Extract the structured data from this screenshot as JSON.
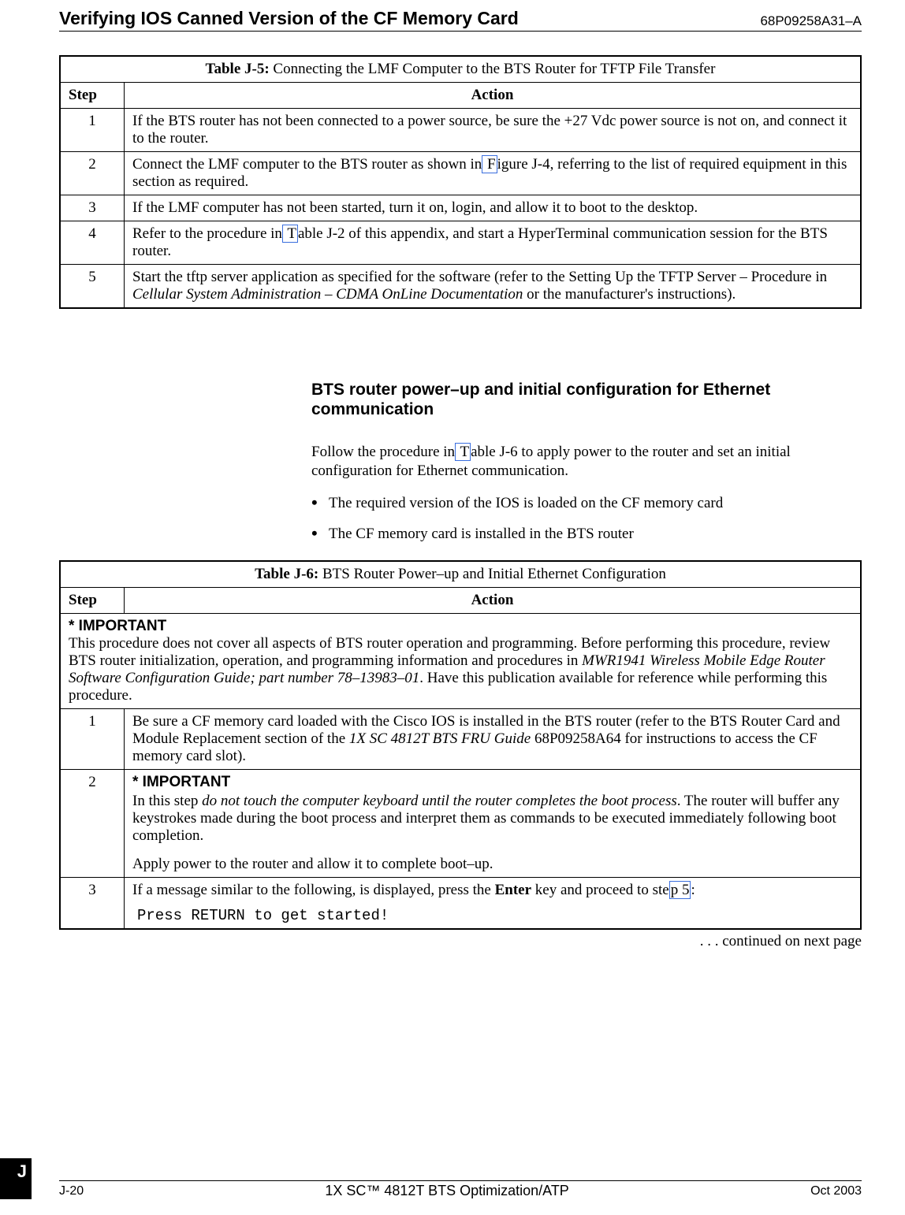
{
  "header": {
    "title": "Verifying IOS Canned Version of the CF Memory Card",
    "doc_num": "68P09258A31–A"
  },
  "table_j5": {
    "title_bold": "Table J-5:",
    "title_rest": " Connecting the LMF Computer to the BTS Router for TFTP File Transfer",
    "h_step": "Step",
    "h_action": "Action",
    "rows": [
      {
        "n": "1",
        "t": "If the BTS router has not been connected to a power source, be sure the +27 Vdc power source is not on, and connect it to the router."
      },
      {
        "n": "2",
        "t_pre": "Connect the LMF computer to the BTS router as shown in",
        "link": " F",
        "t_post": "igure J-4, referring to the list of required equipment in this section as required."
      },
      {
        "n": "3",
        "t": "If the LMF computer has not been started, turn it on, login, and allow it to boot to the desktop."
      },
      {
        "n": "4",
        "t_pre": "Refer to the procedure in",
        "link": " T",
        "t_post": "able J-2 of this appendix, and start a HyperTerminal communication session for the BTS router."
      },
      {
        "n": "5",
        "t_pre": "Start the tftp server application as specified for the software (refer to the Setting Up the TFTP Server – Procedure in ",
        "italic": "Cellular System Administration – CDMA OnLine Documentation",
        "t_post": " or the manufacturer's instructions)."
      }
    ]
  },
  "section": {
    "heading": "BTS router power–up and initial configuration for Ethernet communication",
    "para_pre": " Follow the procedure in",
    "para_link": " T",
    "para_post": "able J-6 to apply power to the router and set an initial configuration for Ethernet communication.",
    "bullet1": "The required version of the IOS is loaded on the CF memory card",
    "bullet2": "The CF memory card is installed in the BTS router"
  },
  "table_j6": {
    "title_bold": "Table J-6:",
    "title_rest": " BTS Router Power–up and Initial Ethernet Configuration",
    "h_step": "Step",
    "h_action": "Action",
    "important": {
      "label": "* IMPORTANT",
      "body_pre": "This procedure does not cover all aspects of BTS router operation and programming. Before performing this procedure, review BTS router initialization, operation, and programming information and procedures in ",
      "italic": "MWR1941 Wireless Mobile Edge Router Software Configuration Guide; part number 78–13983–01",
      "body_post": ". Have this publication available for reference while performing this procedure."
    },
    "row1": {
      "n": "1",
      "pre": "Be sure a CF memory card loaded with the Cisco IOS is installed in the BTS router (refer to the BTS Router Card and Module Replacement section of the ",
      "italic": "1X SC 4812T BTS FRU Guide",
      "post": "  68P09258A64  for instructions to access the CF memory card slot)."
    },
    "row2": {
      "n": "2",
      "imp": "* IMPORTANT",
      "pre": "In this step ",
      "italic": "do not touch the computer keyboard until the router completes the boot process",
      "post": ". The router will buffer any keystrokes made during the boot process and interpret them as commands to be executed immediately following boot completion.",
      "p2": "Apply power to the router and allow it to complete boot–up."
    },
    "row3": {
      "n": "3",
      "pre": "If a message similar to the following, is displayed, press the ",
      "bold": "Enter",
      "mid": " key and proceed to ste",
      "link": "p 5",
      "post": ":",
      "mono": "Press RETURN to get started!"
    }
  },
  "continued": " . . . continued on next page",
  "footer": {
    "left": "J-20",
    "center": "1X SC™ 4812T BTS Optimization/ATP",
    "right": "Oct 2003"
  },
  "tab": "J"
}
